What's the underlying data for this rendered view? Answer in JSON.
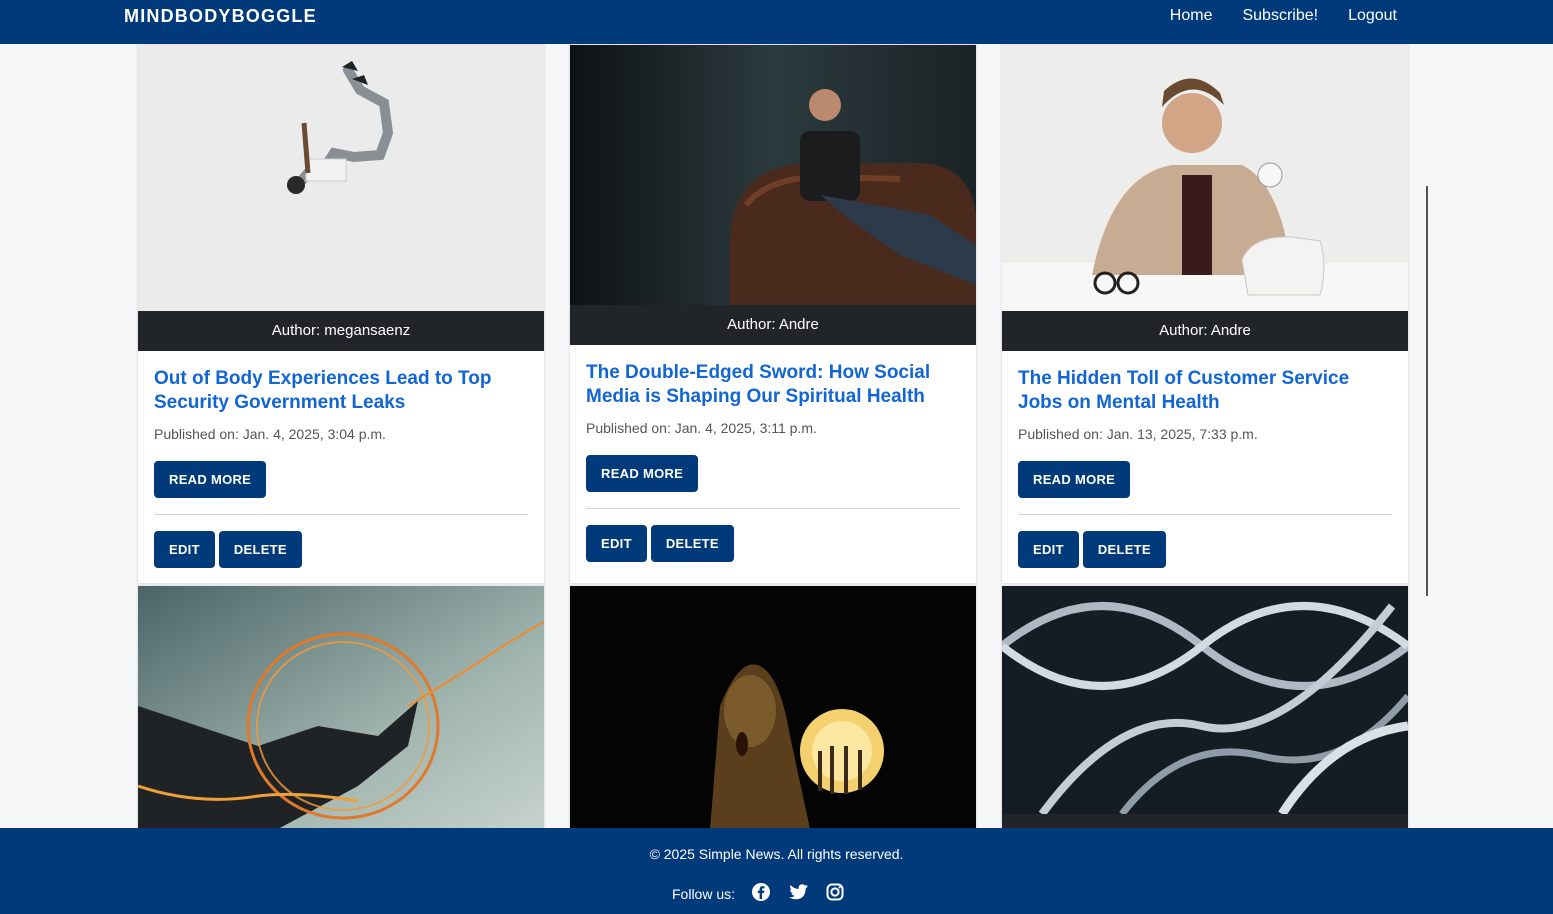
{
  "header": {
    "brand": "MINDBODYBOGGLE",
    "nav": [
      "Home",
      "Subscribe!",
      "Logout"
    ]
  },
  "cards": [
    {
      "author": "Author: megansaenz",
      "title": "Out of Body Experiences Lead to Top Security Government Leaks",
      "published": "Published on: Jan. 4, 2025, 3:04 p.m.",
      "read_more": "Read More",
      "edit": "Edit",
      "delete": "Delete"
    },
    {
      "author": "Author: Andre",
      "title": "The Double-Edged Sword: How Social Media is Shaping Our Spiritual Health",
      "published": "Published on: Jan. 4, 2025, 3:11 p.m.",
      "read_more": "Read More",
      "edit": "Edit",
      "delete": "Delete"
    },
    {
      "author": "Author: Andre",
      "title": "The Hidden Toll of Customer Service Jobs on Mental Health",
      "published": "Published on: Jan. 13, 2025, 7:33 p.m.",
      "read_more": "Read More",
      "edit": "Edit",
      "delete": "Delete"
    }
  ],
  "footer": {
    "copyright": "© 2025 Simple News. All rights reserved.",
    "follow_label": "Follow us:",
    "social_icons": [
      "facebook-icon",
      "twitter-icon",
      "instagram-icon"
    ]
  },
  "colors": {
    "primary": "#003a7a",
    "title_link": "#1266d4",
    "author_bar": "#212529"
  }
}
